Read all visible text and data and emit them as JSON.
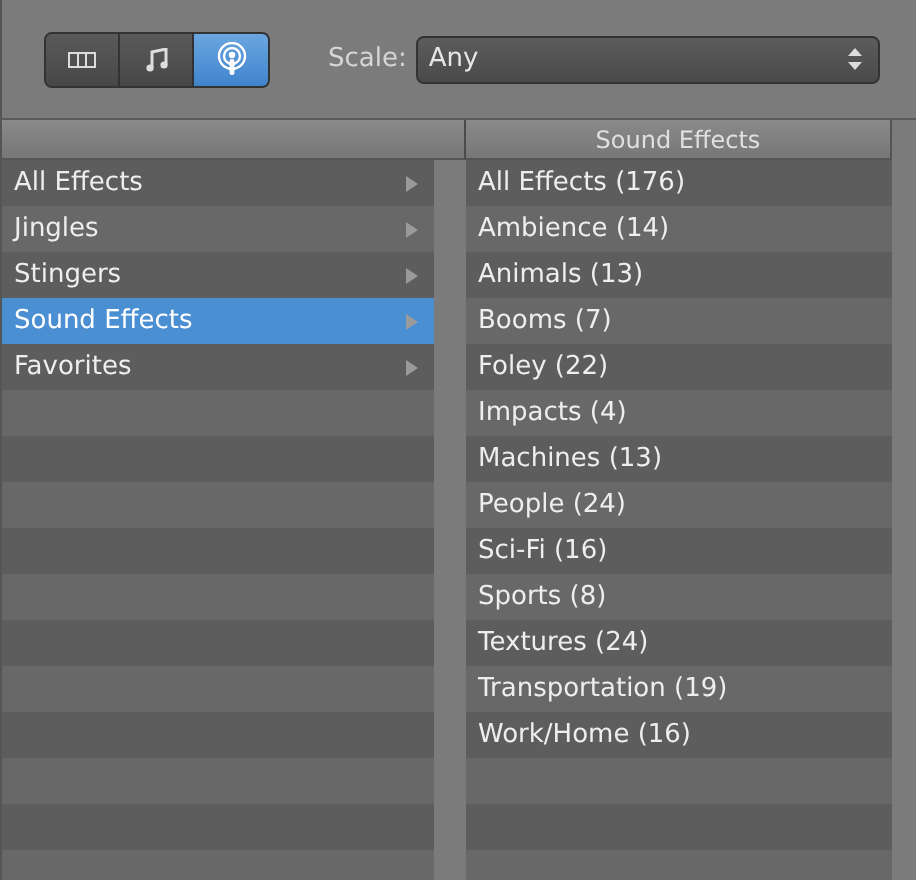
{
  "view_switcher": [
    {
      "kind": "columns",
      "selected": false
    },
    {
      "kind": "music",
      "selected": false
    },
    {
      "kind": "podcast",
      "selected": true
    }
  ],
  "scale": {
    "label": "Scale:",
    "value": "Any"
  },
  "browser": {
    "columns": [
      {
        "items": [
          {
            "label": "All Effects",
            "selected": false
          },
          {
            "label": "Jingles",
            "selected": false
          },
          {
            "label": "Stingers",
            "selected": false
          },
          {
            "label": "Sound Effects",
            "selected": true
          },
          {
            "label": "Favorites",
            "selected": false
          }
        ]
      },
      {
        "header": "Sound Effects",
        "items": [
          {
            "label": "All Effects (176)",
            "selected": false
          },
          {
            "label": "Ambience (14)",
            "selected": false
          },
          {
            "label": "Animals (13)",
            "selected": false
          },
          {
            "label": "Booms (7)",
            "selected": false
          },
          {
            "label": "Foley (22)",
            "selected": false
          },
          {
            "label": "Impacts (4)",
            "selected": false
          },
          {
            "label": "Machines (13)",
            "selected": false
          },
          {
            "label": "People (24)",
            "selected": false
          },
          {
            "label": "Sci-Fi (16)",
            "selected": false
          },
          {
            "label": "Sports (8)",
            "selected": false
          },
          {
            "label": "Textures (24)",
            "selected": false
          },
          {
            "label": "Transportation (19)",
            "selected": false
          },
          {
            "label": "Work/Home (16)",
            "selected": false
          }
        ]
      }
    ]
  }
}
